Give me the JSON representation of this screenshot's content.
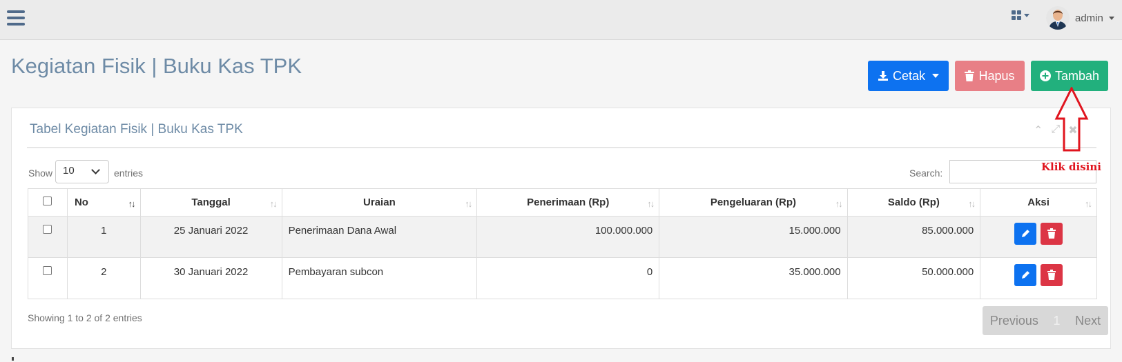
{
  "header": {
    "user_name": "admin"
  },
  "page": {
    "title": "Kegiatan Fisik | Buku Kas TPK"
  },
  "actions": {
    "cetak": "Cetak",
    "hapus": "Hapus",
    "tambah": "Tambah"
  },
  "panel": {
    "title": "Tabel Kegiatan Fisik | Buku Kas TPK"
  },
  "controls": {
    "show": "Show",
    "length": "10",
    "entries": "entries",
    "search": "Search:"
  },
  "table": {
    "headers": [
      "No",
      "Tanggal",
      "Uraian",
      "Penerimaan (Rp)",
      "Pengeluaran (Rp)",
      "Saldo (Rp)",
      "Aksi"
    ],
    "rows": [
      {
        "no": "1",
        "tanggal": "25 Januari 2022",
        "uraian": "Penerimaan Dana Awal",
        "penerimaan": "100.000.000",
        "pengeluaran": "15.000.000",
        "saldo": "85.000.000"
      },
      {
        "no": "2",
        "tanggal": "30 Januari 2022",
        "uraian": "Pembayaran subcon",
        "penerimaan": "0",
        "pengeluaran": "35.000.000",
        "saldo": "50.000.000"
      }
    ]
  },
  "footer": {
    "info": "Showing 1 to 2 of 2 entries",
    "previous": "Previous",
    "page": "1",
    "next": "Next"
  },
  "annotation": {
    "text": "Klik disini"
  },
  "colors": {
    "primary": "#0d72f0",
    "danger_light": "#e87f86",
    "success": "#22b07d",
    "danger": "#dc3545",
    "title": "#6e8ba6",
    "annotation": "#e0141e"
  },
  "icons": [
    "bars-icon",
    "apps-grid-icon",
    "user-avatar-icon",
    "download-icon",
    "trash-icon",
    "plus-circle-icon",
    "pencil-icon",
    "chevron-up-icon",
    "expand-icon",
    "close-icon"
  ]
}
